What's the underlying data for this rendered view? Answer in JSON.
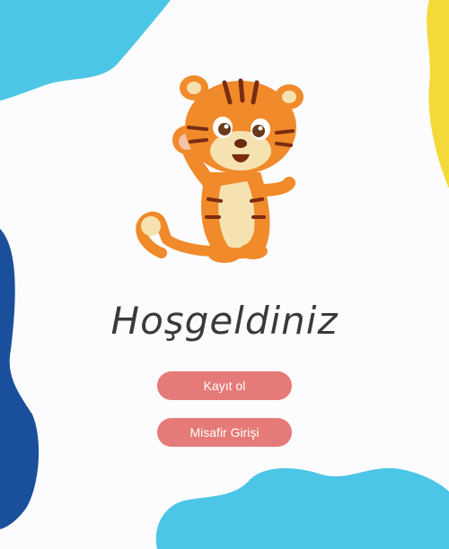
{
  "welcome": {
    "title": "Hoşgeldiniz"
  },
  "buttons": {
    "register_label": "Kayıt ol",
    "guest_label": "Misafir Girişi"
  },
  "colors": {
    "background": "#fcfbfd",
    "blob_light_blue": "#4cc6e6",
    "blob_dark_blue": "#1a4f9c",
    "blob_yellow": "#f3d93a",
    "button": "#e57a78",
    "title_text": "#3a3a3c"
  },
  "icons": {
    "mascot": "tiger-mascot-icon"
  }
}
